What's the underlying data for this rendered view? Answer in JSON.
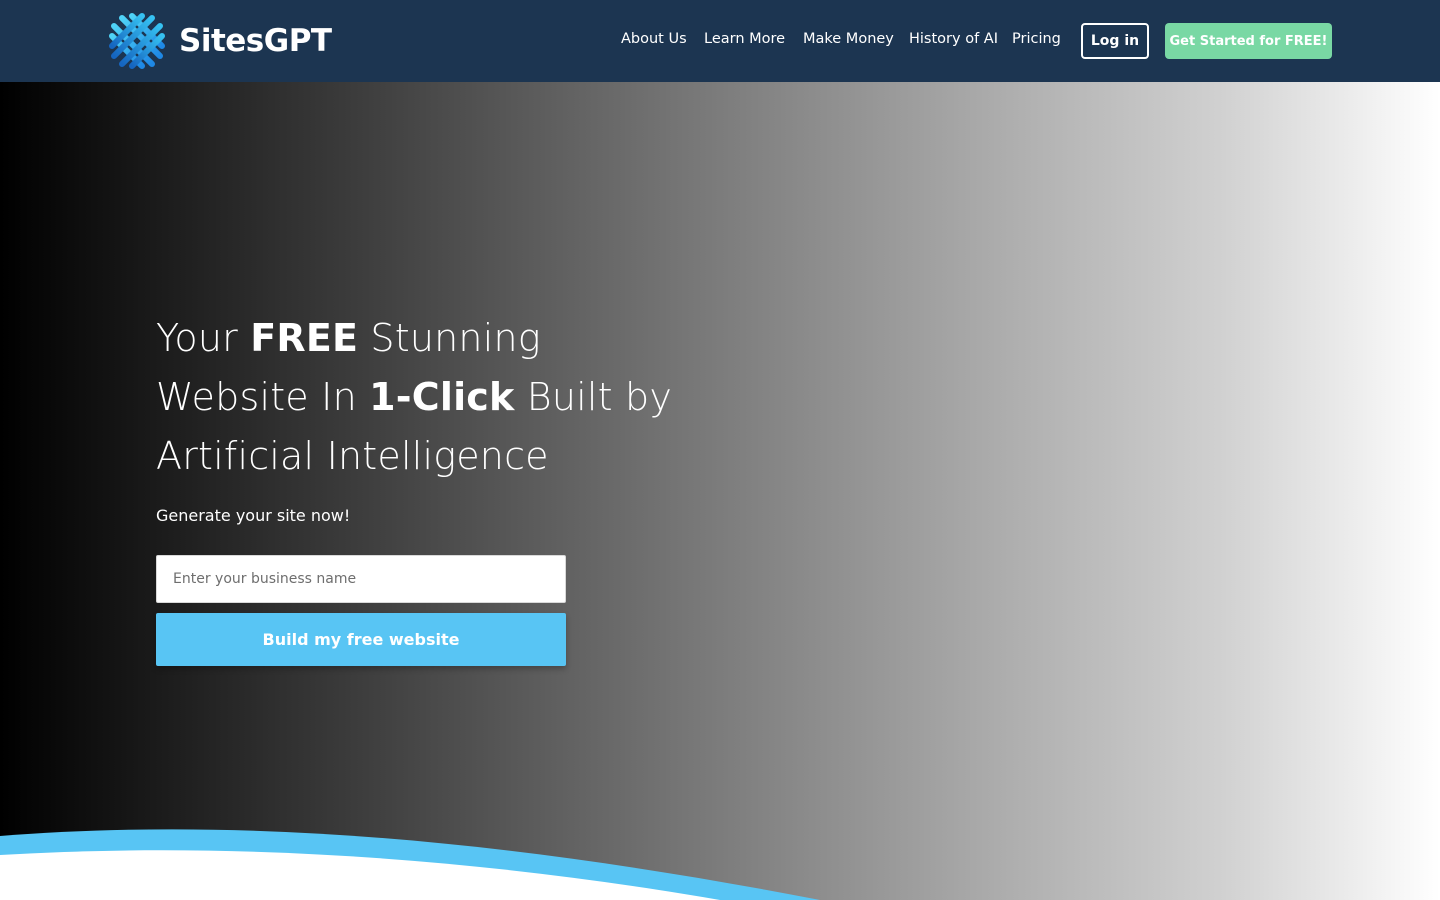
{
  "brand": {
    "name": "SitesGPT",
    "logo_icon": "woven-x-logo-icon",
    "colors": {
      "header_bg": "#1c3551",
      "accent_blue": "#58c5f4",
      "cta_green": "#79d8a4"
    }
  },
  "nav": {
    "items": [
      {
        "label": "About Us"
      },
      {
        "label": "Learn More"
      },
      {
        "label": "Make Money"
      },
      {
        "label": "History of AI"
      },
      {
        "label": "Pricing"
      }
    ],
    "login_label": "Log in",
    "cta_label": "Get Started for FREE!"
  },
  "hero": {
    "headline": {
      "line1_pre": "Your ",
      "line1_bold": "FREE",
      "line1_post": " Stunning",
      "line2_pre": "Website In ",
      "line2_bold": "1-Click",
      "line2_post": " Built by",
      "line3": "Artificial Intelligence"
    },
    "subline": "Generate your site now!",
    "input_placeholder": "Enter your business name",
    "input_value": "",
    "button_label": "Build my free website"
  }
}
